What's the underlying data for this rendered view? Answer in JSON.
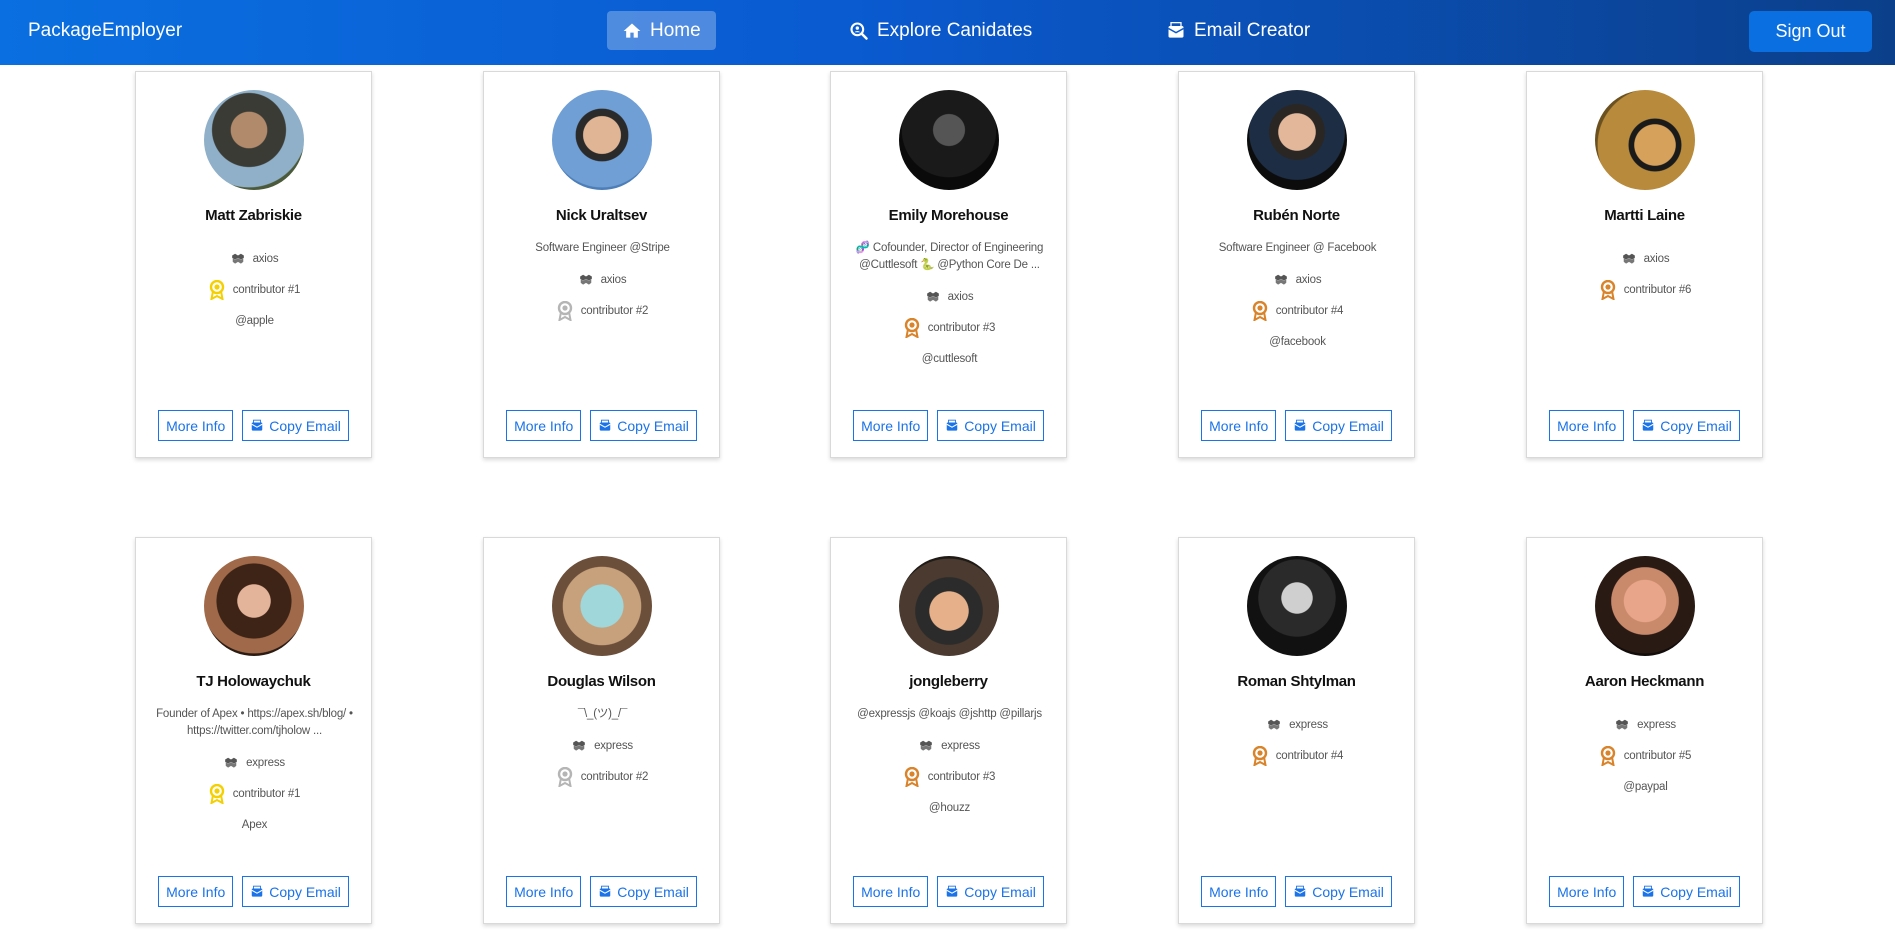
{
  "app": {
    "brand": "PackageEmployer",
    "nav": {
      "home": "Home",
      "explore": "Explore Canidates",
      "email_creator": "Email Creator"
    },
    "sign_out": "Sign Out"
  },
  "colors": {
    "accent": "#1a73e8",
    "gold": "#f5d000",
    "silver": "#b5b5b5",
    "bronze": "#d9832a"
  },
  "card_buttons": {
    "more_info": "More Info",
    "copy_email": "Copy Email"
  },
  "candidates": [
    {
      "name": "Matt Zabriskie",
      "bio": "",
      "package": "axios",
      "rank": "contributor #1",
      "medal": "gold",
      "org": "@apple",
      "avatar": "photo-outdoor"
    },
    {
      "name": "Nick Uraltsev",
      "bio": "Software Engineer @Stripe",
      "package": "axios",
      "rank": "contributor #2",
      "medal": "silver",
      "org": "",
      "avatar": "photo-sky"
    },
    {
      "name": "Emily Morehouse",
      "bio": "🧬 Cofounder, Director of Engineering @Cuttlesoft 🐍 @Python Core De ...",
      "package": "axios",
      "rank": "contributor #3",
      "medal": "bronze",
      "org": "@cuttlesoft",
      "avatar": "photo-dark"
    },
    {
      "name": "Rubén Norte",
      "bio": "Software Engineer @ Facebook",
      "package": "axios",
      "rank": "contributor #4",
      "medal": "bronze",
      "org": "@facebook",
      "avatar": "photo-portrait"
    },
    {
      "name": "Martti Laine",
      "bio": "",
      "package": "axios",
      "rank": "contributor #6",
      "medal": "bronze",
      "org": "",
      "avatar": "photo-gold"
    },
    {
      "name": "TJ Holowaychuk",
      "bio": "Founder of Apex • https://apex.sh/blog/ • https://twitter.com/tjholow ...",
      "package": "express",
      "rank": "contributor #1",
      "medal": "gold",
      "org": "Apex",
      "avatar": "photo-selfie"
    },
    {
      "name": "Douglas Wilson",
      "bio": "¯\\_(ツ)_/¯",
      "package": "express",
      "rank": "contributor #2",
      "medal": "silver",
      "org": "",
      "avatar": "photo-teal"
    },
    {
      "name": "jongleberry",
      "bio": "@expressjs @koajs @jshttp @pillarjs",
      "package": "express",
      "rank": "contributor #3",
      "medal": "bronze",
      "org": "@houzz",
      "avatar": "photo-cap"
    },
    {
      "name": "Roman Shtylman",
      "bio": "",
      "package": "express",
      "rank": "contributor #4",
      "medal": "bronze",
      "org": "",
      "avatar": "photo-bw"
    },
    {
      "name": "Aaron Heckmann",
      "bio": "",
      "package": "express",
      "rank": "contributor #5",
      "medal": "bronze",
      "org": "@paypal",
      "avatar": "photo-red"
    }
  ]
}
